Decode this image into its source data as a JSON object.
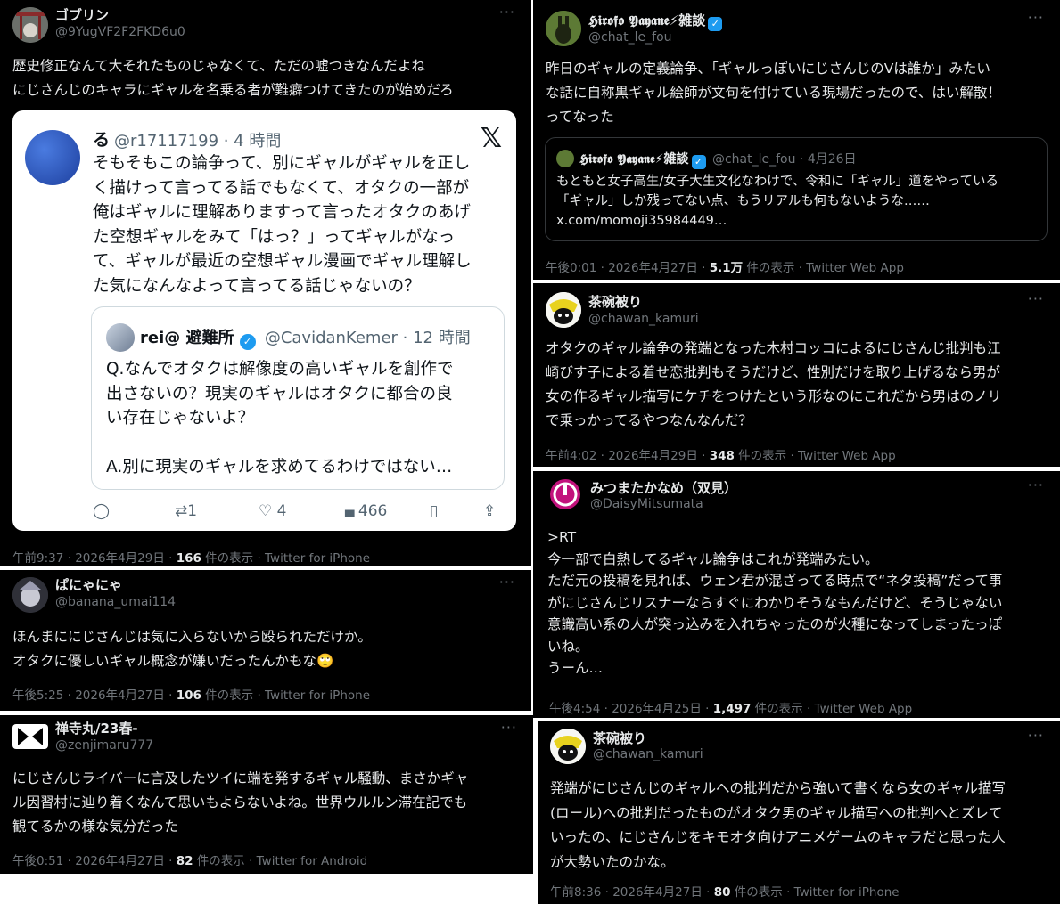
{
  "posts": {
    "p1": {
      "name": "ゴブリン",
      "handle": "@9YugVF2F2FKD6u0",
      "more": "···",
      "text": "歴史修正なんて大それたものじゃなくて、ただの嘘つきなんだよね\nにじさんじのキャラにギャルを名乗る者が難癖つけてきたのが始めだろ",
      "embed": {
        "author": "る",
        "handle_time": "@r17117199 · 4 時間",
        "x_logo": "𝕏",
        "text": "そもそもこの論争って、別にギャルがギャルを正し\nく描けって言ってる話でもなくて、オタクの一部が\n俺はギャルに理解ありますって言ったオタクのあげ\nた空想ギャルをみて「はっ？」ってギャルがなっ\nて、ギャルが最近の空想ギャル漫画でギャル理解し\nた気になんなよって言ってる話じゃないの？",
        "quote": {
          "name": "rei@ 避難所",
          "verified": "✓",
          "handle_time": "@CavidanKemer · 12 時間",
          "text": "Q.なんでオタクは解像度の高いギャルを創作で\n出さないの？現実のギャルはオタクに都合の良\nい存在じゃないよ？\n\nA.別に現実のギャルを求めてるわけではない…"
        },
        "actions": {
          "reply": "◯",
          "retweet_icon": "⇄",
          "retweet_count": "1",
          "like_icon": "♡",
          "like_count": "4",
          "views_icon": "▮▮▮",
          "views_count": "466",
          "bookmark": "▯",
          "share": "⇪"
        }
      },
      "meta_pre": "午前9:37 · 2026年4月29日 · ",
      "views": "166",
      "meta_post": " 件の表示 · Twitter for iPhone"
    },
    "p2": {
      "name": "ぱにゃにゃ",
      "handle": "@banana_umai114",
      "more": "···",
      "text": "ほんまににじさんじは気に入らないから殴られただけか。\nオタクに優しいギャル概念が嫌いだったんかもな",
      "emoji": "🙄",
      "meta_pre": "午後5:25 · 2026年4月27日 · ",
      "views": "106",
      "meta_post": " 件の表示 · Twitter for iPhone"
    },
    "p3": {
      "name": "禅寺丸/23春-",
      "handle": "@zenjimaru777",
      "more": "···",
      "text": "にじさんじライバーに言及したツイに端を発するギャル騒動、まさかギャ\nル因習村に辿り着くなんて思いもよらないよね。世界ウルルン滞在記でも\n観てるかの様な気分だった",
      "meta_pre": "午後0:51 · 2026年4月27日 · ",
      "views": "82",
      "meta_post": " 件の表示 · Twitter for Android"
    },
    "p4": {
      "name": "𝕳𝖎𝖗𝖔𝖋𝖔 𝖄𝖆𝖞𝖆𝖓𝖊⚡雑談",
      "verified": "✓",
      "handle": "@chat_le_fou",
      "more": "···",
      "text": "昨日のギャルの定義論争、「ギャルっぽいにじさんじのVは誰か」みたい\nな話に自称黒ギャル絵師が文句を付けている現場だったので、はい解散！\nってなった",
      "quote": {
        "name": "𝕳𝖎𝖗𝖔𝖋𝖔 𝖄𝖆𝖞𝖆𝖓𝖊⚡雑談",
        "verified": "✓",
        "handle_time": "@chat_le_fou · 4月26日",
        "text": "もともと女子高生/女子大生文化なわけで、令和に「ギャル」道をやっている\n「ギャル」しか残ってない点、もうリアルも何もないような……\nx.com/momoji35984449…"
      },
      "meta_pre": "午後0:01 · 2026年4月27日 · ",
      "views": "5.1万",
      "meta_post": " 件の表示 · Twitter Web App"
    },
    "p5": {
      "name": "茶碗被り",
      "handle": "@chawan_kamuri",
      "more": "···",
      "text": "オタクのギャル論争の発端となった木村コッコによるにじさんじ批判も江\n崎びす子による着せ恋批判もそうだけど、性別だけを取り上げるなら男が\n女の作るギャル描写にケチをつけたという形なのにこれだから男はのノリ\nで乗っかってるやつなんなんだ？",
      "meta_pre": "午前4:02 · 2026年4月29日 · ",
      "views": "348",
      "meta_post": " 件の表示 · Twitter Web App"
    },
    "p6": {
      "name": "みつまたかなめ（双見）",
      "handle": "@DaisyMitsumata",
      "more": "···",
      "text": ">RT\n今一部で白熱してるギャル論争はこれが発端みたい。\nただ元の投稿を見れば、ウェン君が混ざってる時点で“ネタ投稿”だって事\nがにじさんじリスナーならすぐにわかりそうなもんだけど、そうじゃない\n意識高い系の人が突っ込みを入れちゃったのが火種になってしまったっぽ\nいね。\nうーん…",
      "meta_pre": "午後4:54 · 2026年4月25日 · ",
      "views": "1,497",
      "meta_post": " 件の表示 · Twitter Web App"
    },
    "p7": {
      "name": "茶碗被り",
      "handle": "@chawan_kamuri",
      "more": "···",
      "text": "発端がにじさんじのギャルへの批判だから強いて書くなら女のギャル描写\n(ロール)への批判だったものがオタク男のギャル描写への批判へとズレて\nいったの、にじさんじをキモオタ向けアニメゲームのキャラだと思った人\nが大勢いたのかな。",
      "meta_pre": "午前8:36 · 2026年4月27日 · ",
      "views": "80",
      "meta_post": " 件の表示 · Twitter for iPhone"
    }
  }
}
